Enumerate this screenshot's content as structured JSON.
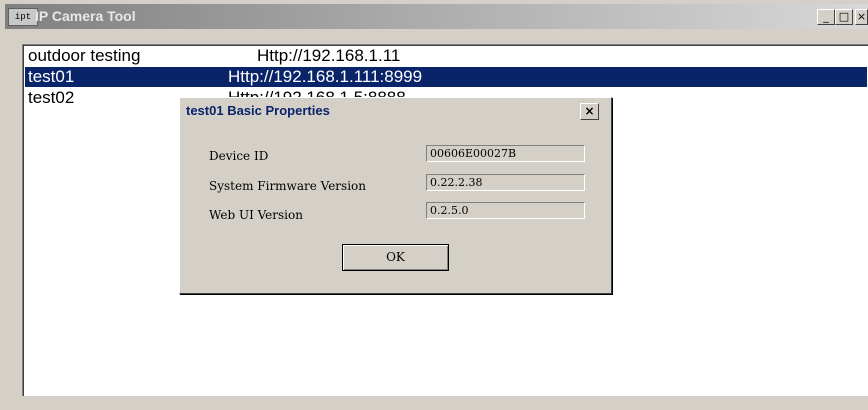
{
  "window": {
    "title": "IP Camera Tool",
    "icon_text": "ipt",
    "minimize_glyph": "_",
    "maximize_glyph": "□",
    "close_glyph": "×"
  },
  "cameras": [
    {
      "name": "outdoor testing",
      "url": "Http://192.168.1.11",
      "selected": false
    },
    {
      "name": "test01",
      "url": "Http://192.168.1.111:8999",
      "selected": true
    },
    {
      "name": "test02",
      "url": "Http://192.168.1.5:8888",
      "selected": false
    }
  ],
  "dialog": {
    "title": "test01 Basic Properties",
    "close_glyph": "×",
    "properties": [
      {
        "label": "Device ID",
        "value": "00606E00027B"
      },
      {
        "label": "System Firmware Version",
        "value": "0.22.2.38"
      },
      {
        "label": "Web UI Version",
        "value": "0.2.5.0"
      }
    ],
    "ok_label": "OK"
  },
  "colors": {
    "selection": "#0a246a",
    "face": "#d4d0c8"
  }
}
